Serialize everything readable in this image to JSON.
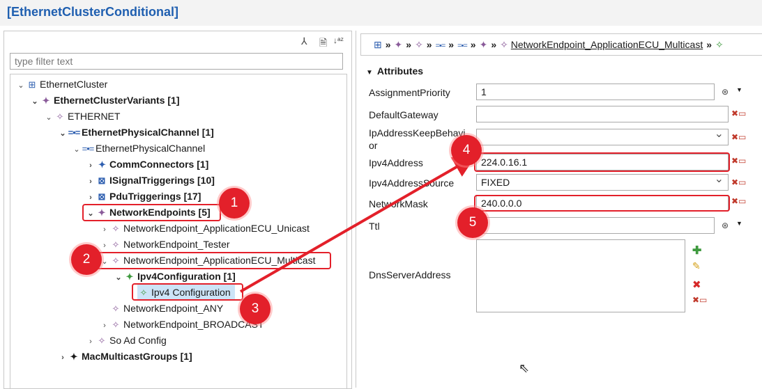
{
  "window": {
    "title": "[EthernetClusterConditional]"
  },
  "left_toolbar": {
    "icons": [
      "hierarchy-icon",
      "document-icon",
      "sort-az-icon"
    ],
    "glyphs": [
      "⅄",
      "🗎",
      "↓ᵃᶻ"
    ]
  },
  "filter": {
    "placeholder": "type filter text",
    "value": ""
  },
  "tree": {
    "items": [
      {
        "label": "EthernetCluster",
        "icon": "cluster-icon",
        "bold": false
      },
      {
        "label": "EthernetClusterVariants [1]",
        "icon": "variant-icon",
        "bold": true
      },
      {
        "label": "ETHERNET",
        "icon": "variant-icon",
        "bold": false
      },
      {
        "label": "EthernetPhysicalChannel [1]",
        "icon": "channel-icon",
        "bold": true
      },
      {
        "label": "EthernetPhysicalChannel",
        "icon": "channel-icon",
        "bold": false
      },
      {
        "label": "CommConnectors [1]",
        "icon": "connector-icon",
        "bold": true
      },
      {
        "label": "ISignalTriggerings [10]",
        "icon": "signal-icon",
        "bold": true
      },
      {
        "label": "PduTriggerings [17]",
        "icon": "pdu-icon",
        "bold": true
      },
      {
        "label": "NetworkEndpoints [5]",
        "icon": "endpoint-icon",
        "bold": true
      },
      {
        "label": "NetworkEndpoint_ApplicationECU_Unicast",
        "icon": "endpoint-icon",
        "bold": false
      },
      {
        "label": "NetworkEndpoint_Tester",
        "icon": "endpoint-icon",
        "bold": false
      },
      {
        "label": "NetworkEndpoint_ApplicationECU_Multicast",
        "icon": "endpoint-icon",
        "bold": false
      },
      {
        "label": "Ipv4Configuration [1]",
        "icon": "config-icon",
        "bold": true
      },
      {
        "label": "Ipv4 Configuration",
        "icon": "config-icon",
        "bold": false,
        "selected": true
      },
      {
        "label": "NetworkEndpoint_ANY",
        "icon": "endpoint-icon",
        "bold": false
      },
      {
        "label": "NetworkEndpoint_BROADCAST",
        "icon": "endpoint-icon",
        "bold": false
      },
      {
        "label": "So Ad Config",
        "icon": "config-icon",
        "bold": false
      },
      {
        "label": "MacMulticastGroups [1]",
        "icon": "config-icon",
        "bold": true
      }
    ]
  },
  "breadcrumb": {
    "current": "NetworkEndpoint_ApplicationECU_Multicast",
    "separator": "»"
  },
  "attributes": {
    "section_title": "Attributes",
    "fields": [
      {
        "label": "AssignmentPriority",
        "value": "1"
      },
      {
        "label": "DefaultGateway",
        "value": ""
      },
      {
        "label": "IpAddressKeepBehavior",
        "value": "",
        "label_line1": "IpAddressKeepBehavi",
        "label_line2": "or"
      },
      {
        "label": "Ipv4Address",
        "value": "224.0.16.1"
      },
      {
        "label": "Ipv4AddressSource",
        "value": "FIXED"
      },
      {
        "label": "NetworkMask",
        "value": "240.0.0.0"
      },
      {
        "label": "Ttl",
        "value": ""
      },
      {
        "label": "DnsServerAddress",
        "value": ""
      }
    ]
  },
  "annotations": {
    "badges": [
      "1",
      "2",
      "3",
      "4",
      "5"
    ]
  },
  "colors": {
    "title": "#1f5fb0",
    "highlight": "#e3202a",
    "selection": "#cce4f7"
  }
}
